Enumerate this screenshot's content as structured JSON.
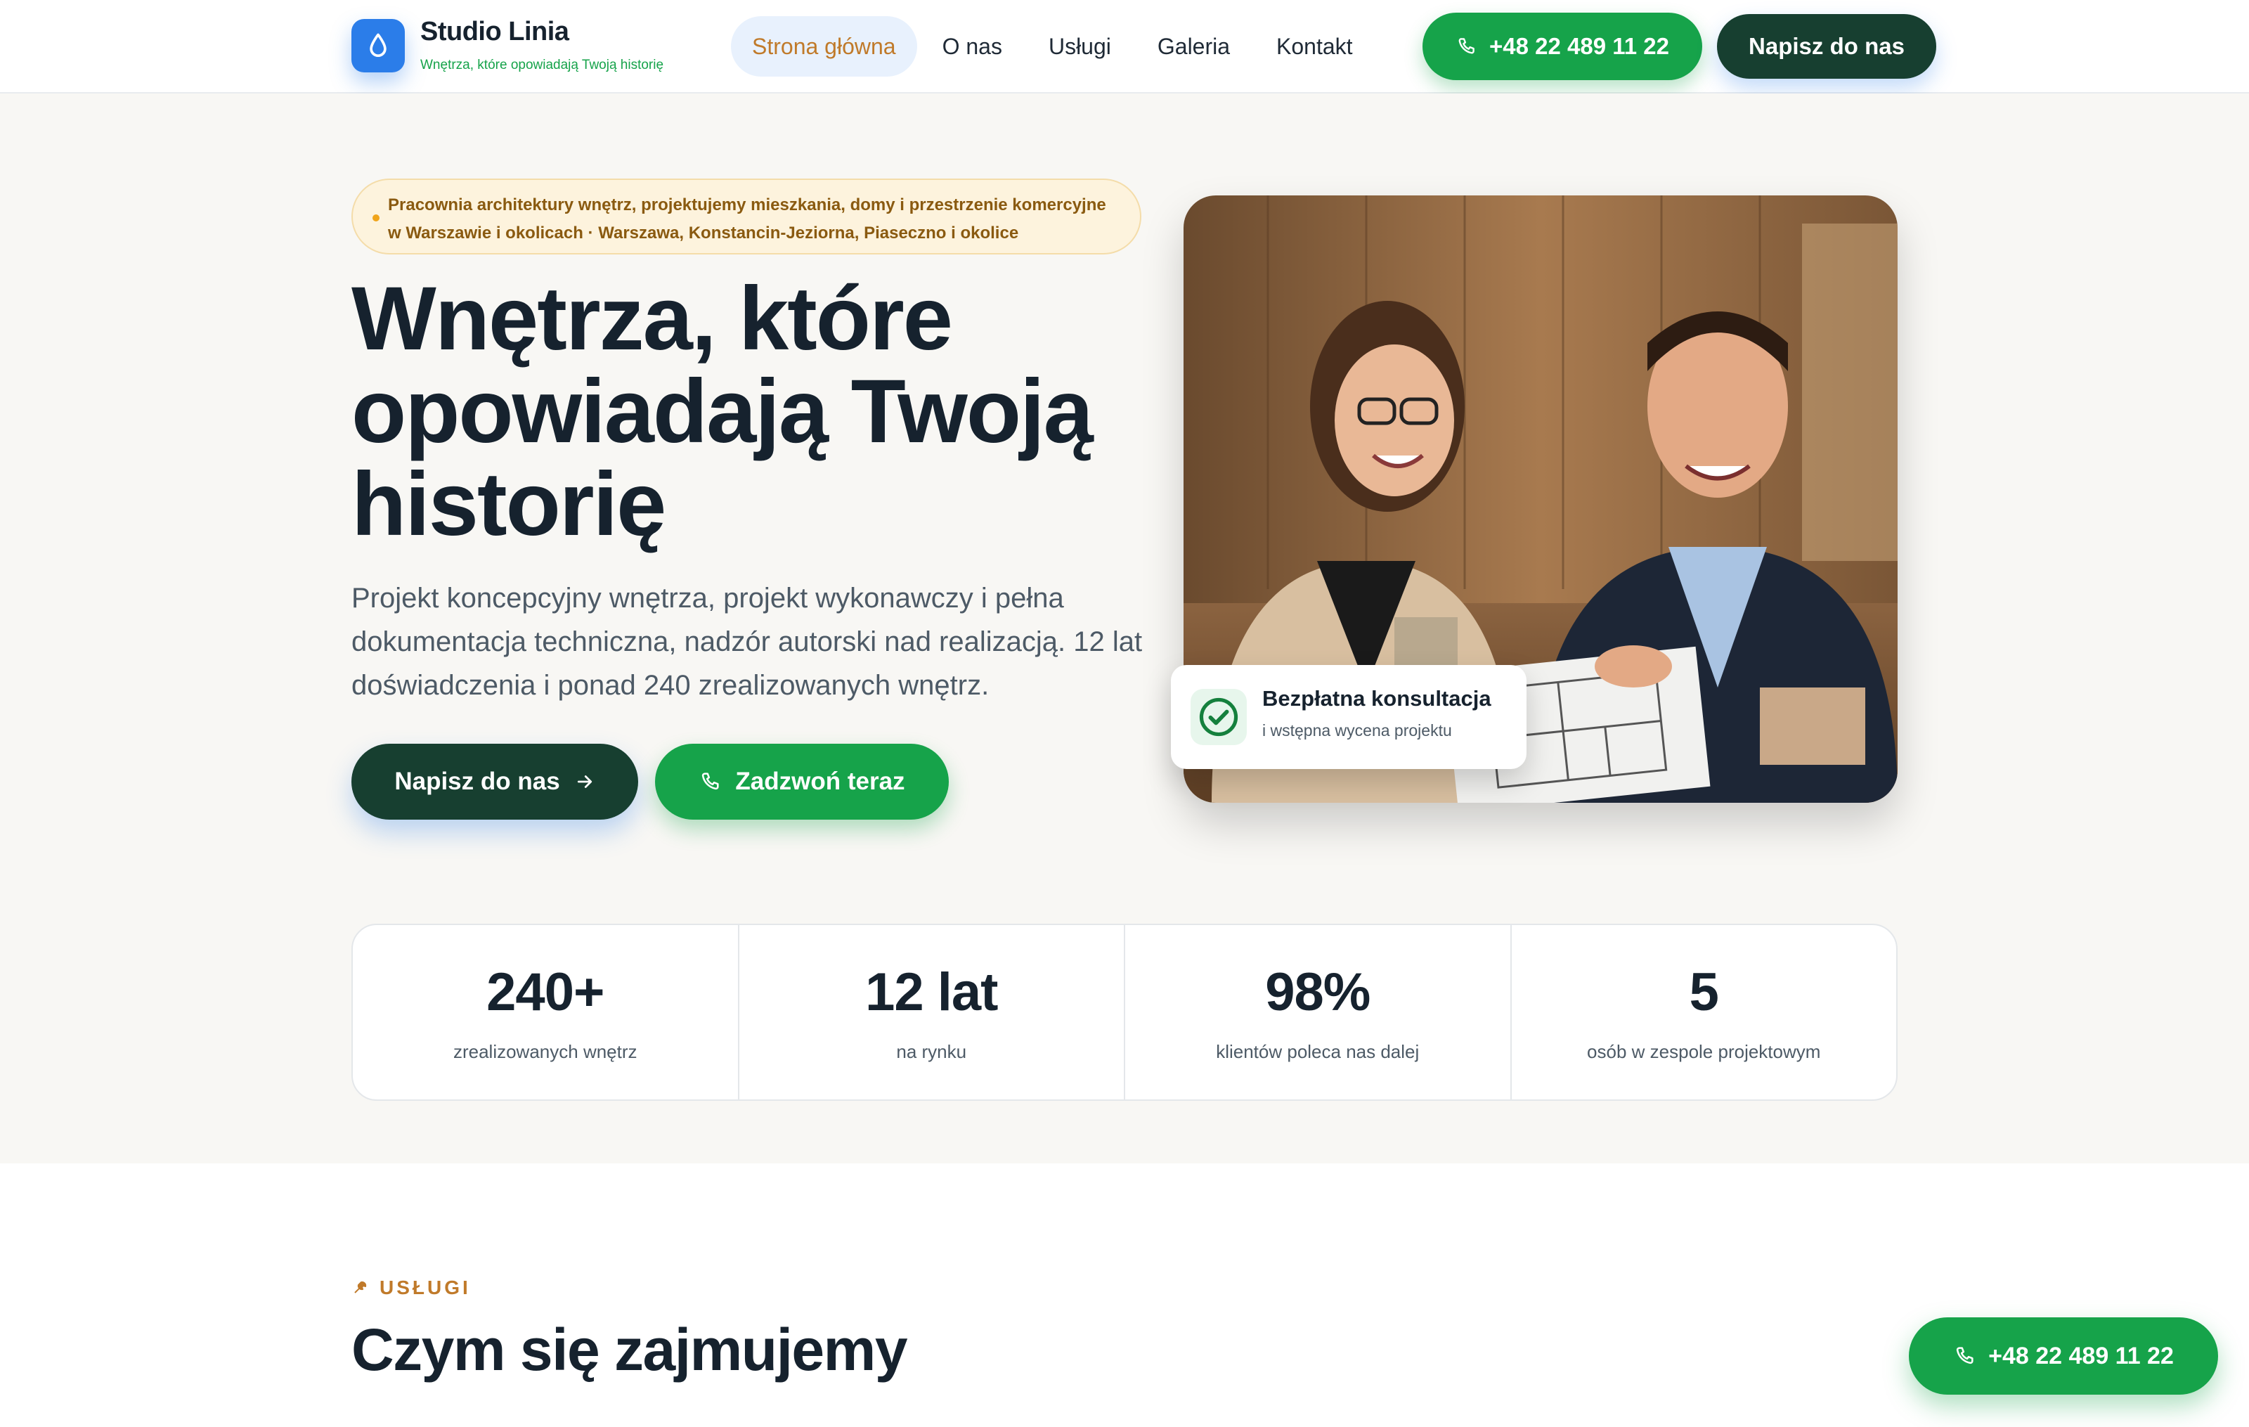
{
  "brand": {
    "name": "Studio Linia",
    "tagline": "Wnętrza, które opowiadają Twoją historię",
    "logo_icon": "drop-icon",
    "accent": "#2b7de9"
  },
  "nav": {
    "links": [
      {
        "label": "Strona główna",
        "active": true
      },
      {
        "label": "O nas"
      },
      {
        "label": "Usługi"
      },
      {
        "label": "Galeria"
      },
      {
        "label": "Kontakt"
      }
    ],
    "phone": "+48 22 489 11 22",
    "cta": "Napisz do nas"
  },
  "hero": {
    "badge_line1": "Pracownia architektury wnętrz, projektujemy mieszkania, domy i przestrzenie komercyjne",
    "badge_line2": "w Warszawie i okolicach · Warszawa, Konstancin-Jeziorna, Piaseczno i okolice",
    "title": "Wnętrza, które opowiadają Twoją historię",
    "description": "Projekt koncepcyjny wnętrza, projekt wykonawczy i pełna dokumentacja techniczna, nadzór autorski nad realizacją. 12 lat doświadczenia i ponad 240 zrealizowanych wnętrz.",
    "primary_cta": "Napisz do nas",
    "secondary_cta": "Zadzwoń teraz",
    "consult_title": "Bezpłatna konsultacja",
    "consult_sub": "i wstępna wycena projektu"
  },
  "stats": [
    {
      "value": "240+",
      "label": "zrealizowanych wnętrz"
    },
    {
      "value": "12 lat",
      "label": "na rynku"
    },
    {
      "value": "98%",
      "label": "klientów poleca nas dalej"
    },
    {
      "value": "5",
      "label": "osób w zespole projektowym"
    }
  ],
  "services": {
    "eyebrow": "USŁUGI",
    "title": "Czym się zajmujemy"
  },
  "float_phone": "+48 22 489 11 22",
  "colors": {
    "green": "#16a34a",
    "dark_green": "#173f30",
    "amber": "#c07a2a",
    "text": "#16222e"
  }
}
